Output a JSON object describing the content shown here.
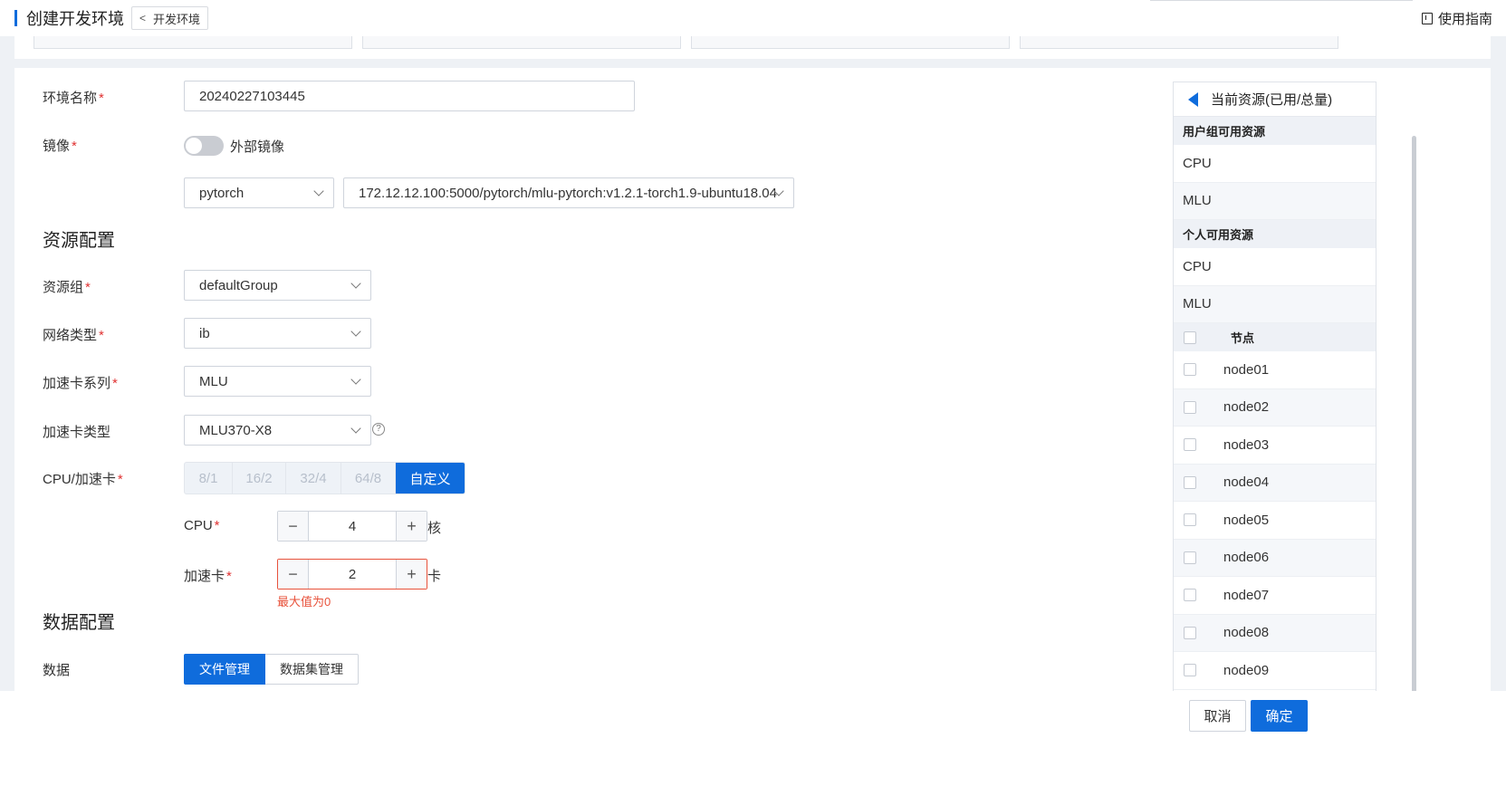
{
  "header": {
    "title": "创建开发环境",
    "back_label": "开发环境",
    "guide_label": "使用指南"
  },
  "form": {
    "env_name": {
      "label": "环境名称",
      "value": "20240227103445"
    },
    "image": {
      "label": "镜像",
      "external_toggle_label": "外部镜像",
      "framework": "pytorch",
      "image_url": "172.12.12.100:5000/pytorch/mlu-pytorch:v1.2.1-torch1.9-ubuntu18.04"
    },
    "resource_section": "资源配置",
    "resource_group": {
      "label": "资源组",
      "value": "defaultGroup"
    },
    "network_type": {
      "label": "网络类型",
      "value": "ib"
    },
    "card_series": {
      "label": "加速卡系列",
      "value": "MLU"
    },
    "card_type": {
      "label": "加速卡类型",
      "value": "MLU370-X8",
      "help": "?"
    },
    "cpu_card": {
      "label": "CPU/加速卡",
      "options": [
        "8/1",
        "16/2",
        "32/4",
        "64/8",
        "自定义"
      ],
      "selected": "自定义"
    },
    "cpu": {
      "label": "CPU",
      "value": "4",
      "unit": "核"
    },
    "card": {
      "label": "加速卡",
      "value": "2",
      "unit": "卡",
      "error": "最大值为0"
    },
    "data_section": "数据配置",
    "data": {
      "label": "数据",
      "tabs": [
        "文件管理",
        "数据集管理"
      ],
      "active": "文件管理"
    }
  },
  "resources": {
    "title": "当前资源(已用/总量)",
    "group_title": "用户组可用资源",
    "group_items": [
      "CPU",
      "MLU"
    ],
    "personal_title": "个人可用资源",
    "personal_items": [
      "CPU",
      "MLU"
    ],
    "node_header": "节点",
    "nodes": [
      "node01",
      "node02",
      "node03",
      "node04",
      "node05",
      "node06",
      "node07",
      "node08",
      "node09"
    ]
  },
  "footer": {
    "cancel": "取消",
    "confirm": "确定"
  },
  "colors": {
    "accent": "#0f6cdc",
    "error": "#e8523b",
    "required": "#e03232"
  }
}
